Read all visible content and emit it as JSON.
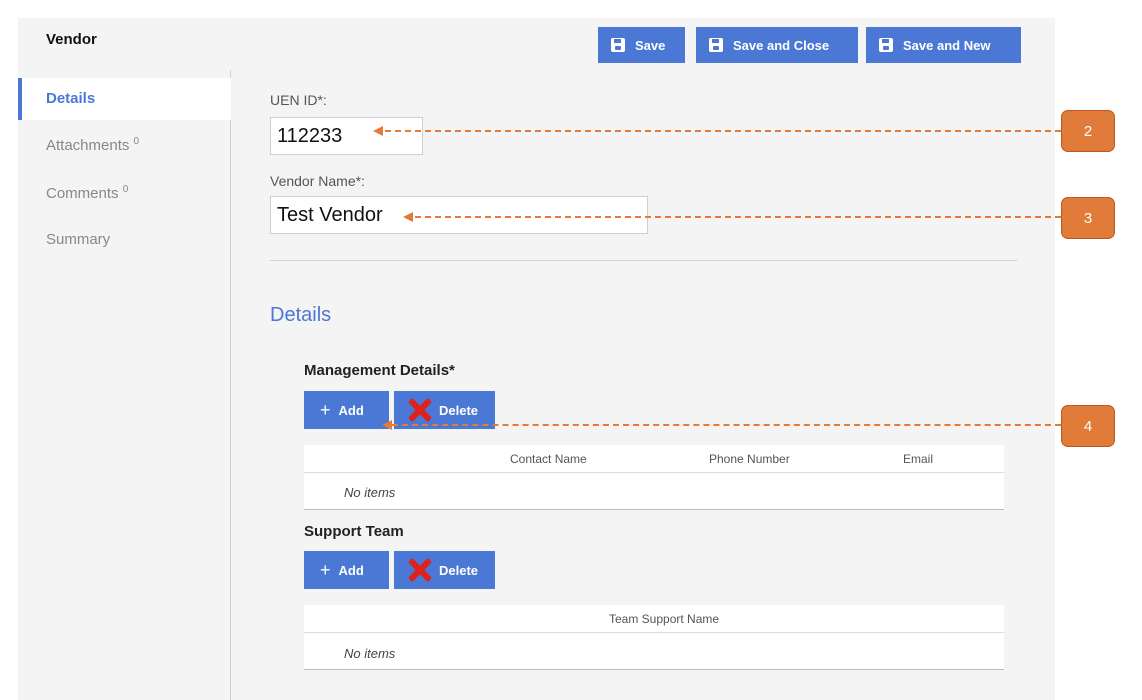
{
  "header": {
    "title": "Vendor",
    "save_label": "Save",
    "save_close_label": "Save and Close",
    "save_new_label": "Save and New"
  },
  "sidebar": {
    "items": [
      {
        "label": "Details",
        "count": ""
      },
      {
        "label": "Attachments",
        "count": "0"
      },
      {
        "label": "Comments",
        "count": "0"
      },
      {
        "label": "Summary",
        "count": ""
      }
    ]
  },
  "form": {
    "uen": {
      "label": "UEN ID*:",
      "value": "112233"
    },
    "vendor_name": {
      "label": "Vendor Name*:",
      "value": "Test Vendor"
    }
  },
  "details": {
    "title": "Details",
    "management": {
      "title": "Management Details*",
      "add_label": "Add",
      "delete_label": "Delete",
      "columns": [
        "Contact Name",
        "Phone Number",
        "Email"
      ],
      "empty_text": "No items"
    },
    "support": {
      "title": "Support Team",
      "add_label": "Add",
      "delete_label": "Delete",
      "columns": [
        "Team Support Name"
      ],
      "empty_text": "No items"
    }
  },
  "callouts": [
    "2",
    "3",
    "4"
  ],
  "colors": {
    "accent": "#4b78d4",
    "callout": "#e07b39",
    "delete": "#e0201b"
  }
}
